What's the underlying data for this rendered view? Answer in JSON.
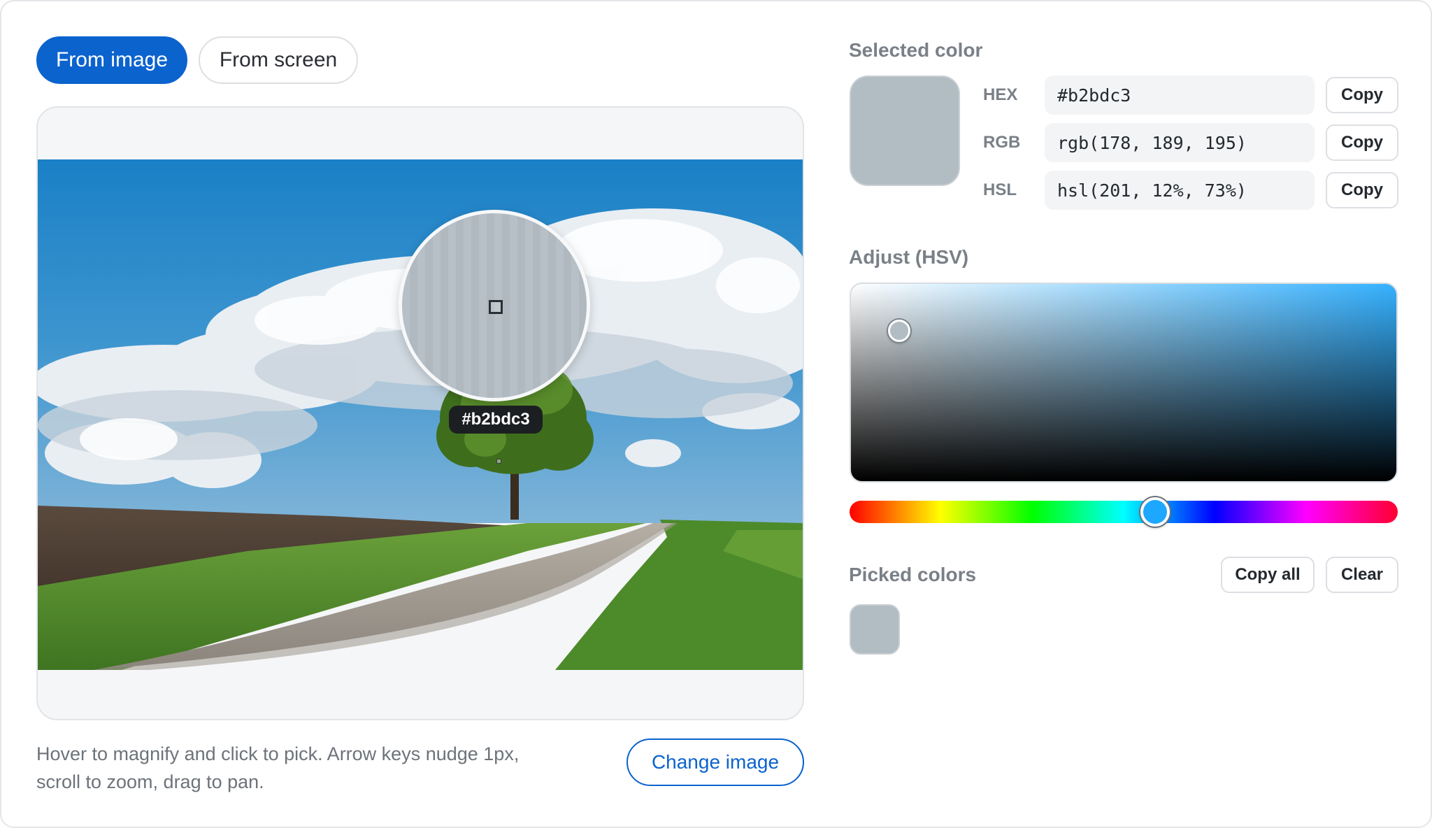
{
  "source_tabs": {
    "from_image": "From image",
    "from_screen": "From screen",
    "active": "from_image"
  },
  "magnifier": {
    "hex_readout": "#b2bdc3"
  },
  "help": {
    "line1": "Hover to magnify and click to pick. Arrow keys nudge 1px,",
    "line2": "scroll to zoom, drag to pan."
  },
  "change_image_label": "Change image",
  "selected": {
    "title": "Selected color",
    "swatch_color": "#b2bdc3",
    "formats": [
      {
        "label": "HEX",
        "value": "#b2bdc3",
        "copy_label": "Copy"
      },
      {
        "label": "RGB",
        "value": "rgb(178, 189, 195)",
        "copy_label": "Copy"
      },
      {
        "label": "HSL",
        "value": "hsl(201, 12%, 73%)",
        "copy_label": "Copy"
      }
    ]
  },
  "adjust": {
    "title": "Adjust (HSV)",
    "hue_fraction": 0.558,
    "saturation_fraction": 0.09,
    "value_fraction": 0.76
  },
  "picked": {
    "title": "Picked colors",
    "copy_all_label": "Copy all",
    "clear_label": "Clear",
    "colors": [
      "#b2bdc3"
    ]
  },
  "colors": {
    "accent": "#0b63ce",
    "sky_top": "#1b7fc4",
    "grass": "#4f8a2a",
    "road": "#9a938b"
  }
}
